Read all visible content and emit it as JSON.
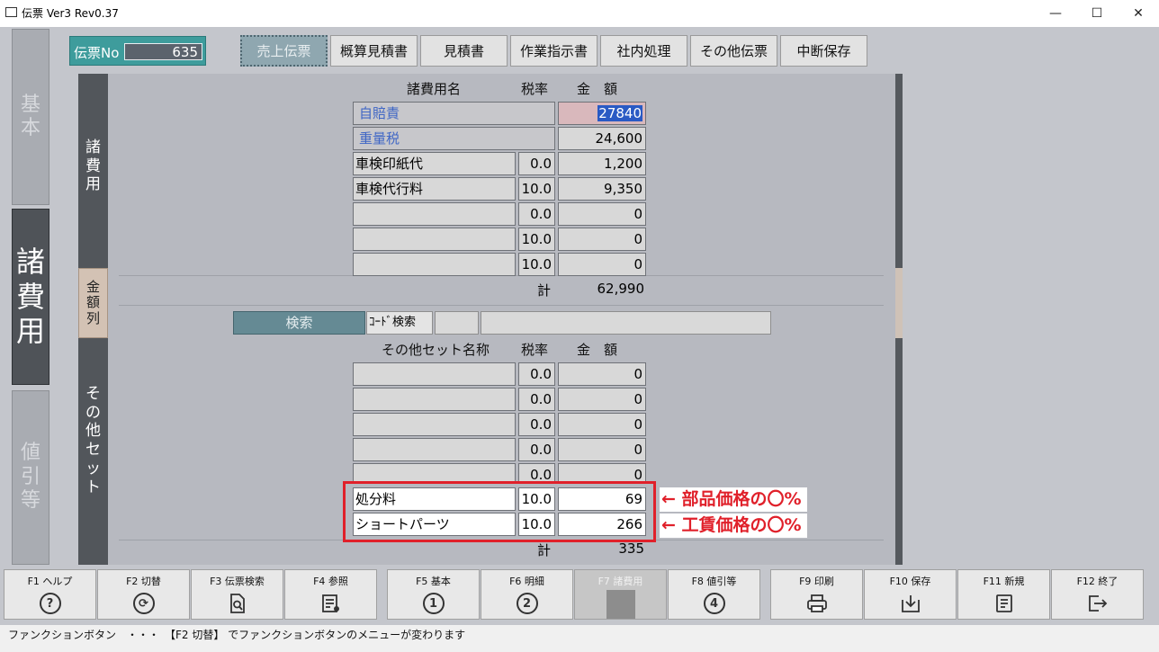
{
  "window": {
    "title": "伝票 Ver3 Rev0.37",
    "minimize": "—",
    "maximize": "☐",
    "close": "✕"
  },
  "left_tabs": {
    "basic": "基本",
    "shohi": "諸費用",
    "nebiki": "値引等"
  },
  "denpyo": {
    "label": "伝票No",
    "value": "635"
  },
  "top_tabs": [
    "売上伝票",
    "概算見積書",
    "見積書",
    "作業指示書",
    "社内処理",
    "その他伝票",
    "中断保存"
  ],
  "shohi": {
    "section_label": "諸費用",
    "headers": {
      "name": "諸費用名",
      "rate": "税率",
      "amount": "金　額"
    },
    "fixed_rows": [
      {
        "name": "自賠責",
        "amount": "27840"
      },
      {
        "name": "重量税",
        "amount": "24,600"
      }
    ],
    "rows": [
      {
        "name": "車検印紙代",
        "rate": "0.0",
        "amount": "1,200"
      },
      {
        "name": "車検代行料",
        "rate": "10.0",
        "amount": "9,350"
      },
      {
        "name": "",
        "rate": "0.0",
        "amount": "0"
      },
      {
        "name": "",
        "rate": "10.0",
        "amount": "0"
      },
      {
        "name": "",
        "rate": "10.0",
        "amount": "0"
      }
    ],
    "total_label": "計",
    "total_value": "62,990"
  },
  "kingaku_tab": "金額列",
  "search": {
    "button": "検索",
    "code_label": "ｺｰﾄﾞ検索",
    "code_value": "",
    "name_value": ""
  },
  "other_set": {
    "section_label": "その他セット",
    "headers": {
      "name": "その他セット名称",
      "rate": "税率",
      "amount": "金　額"
    },
    "rows": [
      {
        "name": "",
        "rate": "0.0",
        "amount": "0"
      },
      {
        "name": "",
        "rate": "0.0",
        "amount": "0"
      },
      {
        "name": "",
        "rate": "0.0",
        "amount": "0"
      },
      {
        "name": "",
        "rate": "0.0",
        "amount": "0"
      },
      {
        "name": "",
        "rate": "0.0",
        "amount": "0"
      },
      {
        "name": "処分料",
        "rate": "10.0",
        "amount": "69"
      },
      {
        "name": "ショートパーツ",
        "rate": "10.0",
        "amount": "266"
      }
    ],
    "total_label": "計",
    "total_value": "335"
  },
  "annotations": [
    "← 部品価格の〇%",
    "← 工賃価格の〇%"
  ],
  "function_keys": [
    {
      "label": "F1 ヘルプ",
      "icon": "help-icon",
      "glyph": "?"
    },
    {
      "label": "F2 切替",
      "icon": "switch-icon",
      "glyph": "⟳"
    },
    {
      "label": "F3 伝票検索",
      "icon": "doc-search-icon",
      "glyph": ""
    },
    {
      "label": "F4 参照",
      "icon": "reference-icon",
      "glyph": ""
    },
    {
      "label": "F5 基本",
      "icon": "number-1-icon",
      "glyph": "1"
    },
    {
      "label": "F6 明細",
      "icon": "number-2-icon",
      "glyph": "2"
    },
    {
      "label": "F7 諸費用",
      "icon": "disabled-icon",
      "glyph": ""
    },
    {
      "label": "F8 値引等",
      "icon": "number-4-icon",
      "glyph": "4"
    },
    {
      "label": "F9 印刷",
      "icon": "printer-icon",
      "glyph": ""
    },
    {
      "label": "F10 保存",
      "icon": "save-icon",
      "glyph": ""
    },
    {
      "label": "F11 新規",
      "icon": "new-doc-icon",
      "glyph": ""
    },
    {
      "label": "F12 終了",
      "icon": "exit-icon",
      "glyph": ""
    }
  ],
  "status_text": "ファンクションボタン　・・・　【F2 切替】 でファンクションボタンのメニューが変わります"
}
